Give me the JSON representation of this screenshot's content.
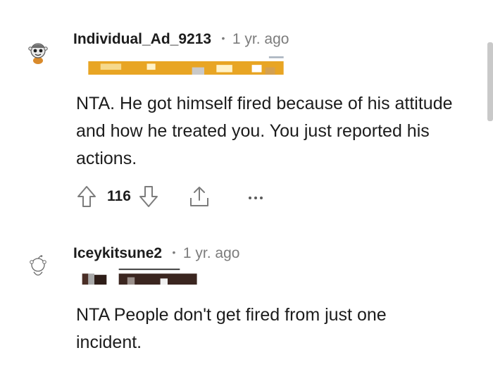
{
  "comments": [
    {
      "username": "Individual_Ad_9213",
      "separator": "•",
      "time": "1 yr. ago",
      "body": "NTA. He got himself fired because of his attitude and how he treated you. You just reported his actions.",
      "score": "116",
      "avatar_icon": "snoo-avatar-icon"
    },
    {
      "username": "Iceykitsune2",
      "separator": "•",
      "time": "1 yr. ago",
      "body": "NTA People don't get fired from just one incident.",
      "avatar_icon": "snoo-avatar-icon"
    }
  ],
  "colors": {
    "flair_orange": "#e8a524",
    "muted": "#7c7c7c",
    "text": "#1c1c1c"
  }
}
